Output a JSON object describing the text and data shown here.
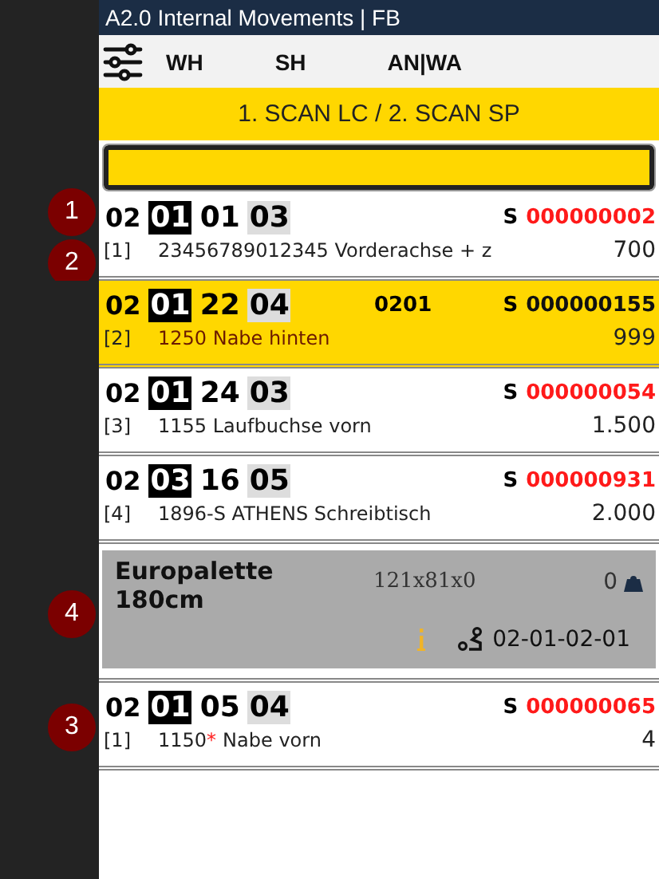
{
  "window": {
    "title": "A2.0 Internal Movements | FB"
  },
  "toolbar": {
    "tabs": [
      {
        "label": "WH"
      },
      {
        "label": "SH"
      },
      {
        "label": "AN|WA"
      }
    ]
  },
  "banner": "1. SCAN LC / 2. SCAN SP",
  "items": [
    {
      "kind": "entry",
      "callouts": [
        "1",
        "2"
      ],
      "selected": false,
      "location": [
        "02",
        "01",
        "01",
        "03"
      ],
      "serial_prefix": "S",
      "serial": "000000002",
      "index": "[1]",
      "article": "23456789012345 Vorderachse + z",
      "qty": "700"
    },
    {
      "kind": "entry",
      "selected": true,
      "location": [
        "02",
        "01",
        "22",
        "04"
      ],
      "middle": "0201",
      "serial_prefix": "S",
      "serial": "000000155",
      "index": "[2]",
      "article": "1250 Nabe hinten",
      "qty": "999"
    },
    {
      "kind": "entry",
      "selected": false,
      "location": [
        "02",
        "01",
        "24",
        "03"
      ],
      "serial_prefix": "S",
      "serial": "000000054",
      "index": "[3]",
      "article": "1155 Laufbuchse vorn",
      "qty": "1.500"
    },
    {
      "kind": "entry",
      "selected": false,
      "location": [
        "02",
        "03",
        "16",
        "05"
      ],
      "serial_prefix": "S",
      "serial": "000000931",
      "index": "[4]",
      "article": "1896-S ATHENS Schreibtisch",
      "qty": "2.000"
    },
    {
      "kind": "pallet",
      "callouts": [
        "4"
      ],
      "name": "Europalette 180cm",
      "dimensions": "121x81x0",
      "weight": "0",
      "route": "02-01-02-01"
    },
    {
      "kind": "entry",
      "callouts": [
        "3"
      ],
      "selected": false,
      "location": [
        "02",
        "01",
        "05",
        "04"
      ],
      "serial_prefix": "S",
      "serial": "000000065",
      "index": "[1]",
      "article_code": "1150",
      "mark": "*",
      "article": "Nabe vorn",
      "qty": "4"
    }
  ]
}
